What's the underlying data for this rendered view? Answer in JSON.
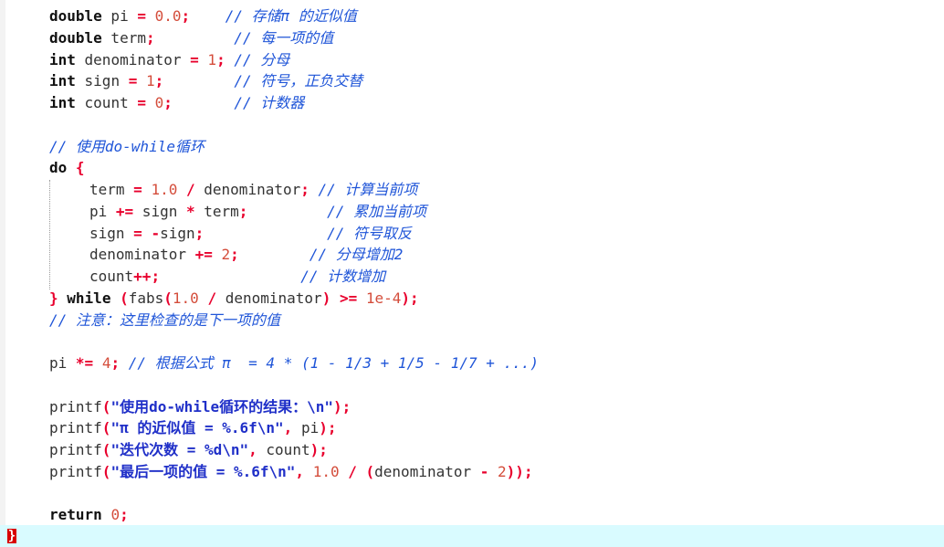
{
  "lines": [
    {
      "parts": [
        {
          "t": "double",
          "c": "kw"
        },
        {
          "t": " pi ",
          "c": "id"
        },
        {
          "t": "=",
          "c": "op"
        },
        {
          "t": " ",
          "c": "id"
        },
        {
          "t": "0.0",
          "c": "num"
        },
        {
          "t": ";",
          "c": "op"
        },
        {
          "t": "    // 存储π 的近似值",
          "c": "cm"
        }
      ]
    },
    {
      "parts": [
        {
          "t": "double",
          "c": "kw"
        },
        {
          "t": " term",
          "c": "id"
        },
        {
          "t": ";",
          "c": "op"
        },
        {
          "t": "         // 每一项的值",
          "c": "cm"
        }
      ]
    },
    {
      "parts": [
        {
          "t": "int",
          "c": "kw"
        },
        {
          "t": " denominator ",
          "c": "id"
        },
        {
          "t": "=",
          "c": "op"
        },
        {
          "t": " ",
          "c": "id"
        },
        {
          "t": "1",
          "c": "num"
        },
        {
          "t": ";",
          "c": "op"
        },
        {
          "t": " // 分母",
          "c": "cm"
        }
      ]
    },
    {
      "parts": [
        {
          "t": "int",
          "c": "kw"
        },
        {
          "t": " sign ",
          "c": "id"
        },
        {
          "t": "=",
          "c": "op"
        },
        {
          "t": " ",
          "c": "id"
        },
        {
          "t": "1",
          "c": "num"
        },
        {
          "t": ";",
          "c": "op"
        },
        {
          "t": "        // 符号，正负交替",
          "c": "cm"
        }
      ]
    },
    {
      "parts": [
        {
          "t": "int",
          "c": "kw"
        },
        {
          "t": " count ",
          "c": "id"
        },
        {
          "t": "=",
          "c": "op"
        },
        {
          "t": " ",
          "c": "id"
        },
        {
          "t": "0",
          "c": "num"
        },
        {
          "t": ";",
          "c": "op"
        },
        {
          "t": "       // 计数器",
          "c": "cm"
        }
      ]
    },
    {
      "parts": []
    },
    {
      "parts": [
        {
          "t": "// 使用do-while循环",
          "c": "cm"
        }
      ]
    },
    {
      "parts": [
        {
          "t": "do",
          "c": "kw"
        },
        {
          "t": " ",
          "c": "id"
        },
        {
          "t": "{",
          "c": "op"
        }
      ]
    },
    {
      "indent": true,
      "parts": [
        {
          "t": "term ",
          "c": "id"
        },
        {
          "t": "=",
          "c": "op"
        },
        {
          "t": " ",
          "c": "id"
        },
        {
          "t": "1.0",
          "c": "num"
        },
        {
          "t": " ",
          "c": "id"
        },
        {
          "t": "/",
          "c": "op"
        },
        {
          "t": " denominator",
          "c": "id"
        },
        {
          "t": ";",
          "c": "op"
        },
        {
          "t": " // 计算当前项",
          "c": "cm"
        }
      ]
    },
    {
      "indent": true,
      "parts": [
        {
          "t": "pi ",
          "c": "id"
        },
        {
          "t": "+=",
          "c": "op"
        },
        {
          "t": " sign ",
          "c": "id"
        },
        {
          "t": "*",
          "c": "op"
        },
        {
          "t": " term",
          "c": "id"
        },
        {
          "t": ";",
          "c": "op"
        },
        {
          "t": "         // 累加当前项",
          "c": "cm"
        }
      ]
    },
    {
      "indent": true,
      "parts": [
        {
          "t": "sign ",
          "c": "id"
        },
        {
          "t": "=",
          "c": "op"
        },
        {
          "t": " ",
          "c": "id"
        },
        {
          "t": "-",
          "c": "op"
        },
        {
          "t": "sign",
          "c": "id"
        },
        {
          "t": ";",
          "c": "op"
        },
        {
          "t": "              // 符号取反",
          "c": "cm"
        }
      ]
    },
    {
      "indent": true,
      "parts": [
        {
          "t": "denominator ",
          "c": "id"
        },
        {
          "t": "+=",
          "c": "op"
        },
        {
          "t": " ",
          "c": "id"
        },
        {
          "t": "2",
          "c": "num"
        },
        {
          "t": ";",
          "c": "op"
        },
        {
          "t": "        // 分母增加2",
          "c": "cm"
        }
      ]
    },
    {
      "indent": true,
      "parts": [
        {
          "t": "count",
          "c": "id"
        },
        {
          "t": "++;",
          "c": "op"
        },
        {
          "t": "                // 计数增加",
          "c": "cm"
        }
      ]
    },
    {
      "parts": [
        {
          "t": "}",
          "c": "op"
        },
        {
          "t": " ",
          "c": "id"
        },
        {
          "t": "while",
          "c": "kw"
        },
        {
          "t": " ",
          "c": "id"
        },
        {
          "t": "(",
          "c": "op"
        },
        {
          "t": "fabs",
          "c": "id"
        },
        {
          "t": "(",
          "c": "op"
        },
        {
          "t": "1.0",
          "c": "num"
        },
        {
          "t": " ",
          "c": "id"
        },
        {
          "t": "/",
          "c": "op"
        },
        {
          "t": " denominator",
          "c": "id"
        },
        {
          "t": ")",
          "c": "op"
        },
        {
          "t": " ",
          "c": "id"
        },
        {
          "t": ">=",
          "c": "op"
        },
        {
          "t": " ",
          "c": "id"
        },
        {
          "t": "1e-4",
          "c": "num"
        },
        {
          "t": ");",
          "c": "op"
        }
      ]
    },
    {
      "parts": [
        {
          "t": "// 注意：这里检查的是下一项的值",
          "c": "cm"
        }
      ]
    },
    {
      "parts": []
    },
    {
      "parts": [
        {
          "t": "pi ",
          "c": "id"
        },
        {
          "t": "*=",
          "c": "op"
        },
        {
          "t": " ",
          "c": "id"
        },
        {
          "t": "4",
          "c": "num"
        },
        {
          "t": ";",
          "c": "op"
        },
        {
          "t": " // 根据公式 π  = 4 * (1 - 1/3 + 1/5 - 1/7 + ...)",
          "c": "cm"
        }
      ]
    },
    {
      "parts": []
    },
    {
      "parts": [
        {
          "t": "printf",
          "c": "id"
        },
        {
          "t": "(",
          "c": "op"
        },
        {
          "t": "\"使用do-while循环的结果：\\n\"",
          "c": "str"
        },
        {
          "t": ");",
          "c": "op"
        }
      ]
    },
    {
      "parts": [
        {
          "t": "printf",
          "c": "id"
        },
        {
          "t": "(",
          "c": "op"
        },
        {
          "t": "\"π 的近似值 = %.6f\\n\"",
          "c": "str"
        },
        {
          "t": ",",
          "c": "op"
        },
        {
          "t": " pi",
          "c": "id"
        },
        {
          "t": ");",
          "c": "op"
        }
      ]
    },
    {
      "parts": [
        {
          "t": "printf",
          "c": "id"
        },
        {
          "t": "(",
          "c": "op"
        },
        {
          "t": "\"迭代次数 = %d\\n\"",
          "c": "str"
        },
        {
          "t": ",",
          "c": "op"
        },
        {
          "t": " count",
          "c": "id"
        },
        {
          "t": ");",
          "c": "op"
        }
      ]
    },
    {
      "parts": [
        {
          "t": "printf",
          "c": "id"
        },
        {
          "t": "(",
          "c": "op"
        },
        {
          "t": "\"最后一项的值 = %.6f\\n\"",
          "c": "str"
        },
        {
          "t": ",",
          "c": "op"
        },
        {
          "t": " ",
          "c": "id"
        },
        {
          "t": "1.0",
          "c": "num"
        },
        {
          "t": " ",
          "c": "id"
        },
        {
          "t": "/",
          "c": "op"
        },
        {
          "t": " ",
          "c": "id"
        },
        {
          "t": "(",
          "c": "op"
        },
        {
          "t": "denominator ",
          "c": "id"
        },
        {
          "t": "-",
          "c": "op"
        },
        {
          "t": " ",
          "c": "id"
        },
        {
          "t": "2",
          "c": "num"
        },
        {
          "t": "));",
          "c": "op"
        }
      ]
    },
    {
      "parts": []
    },
    {
      "parts": [
        {
          "t": "return",
          "c": "kw"
        },
        {
          "t": " ",
          "c": "id"
        },
        {
          "t": "0",
          "c": "num"
        },
        {
          "t": ";",
          "c": "op"
        }
      ]
    }
  ],
  "closing_brace": "}"
}
